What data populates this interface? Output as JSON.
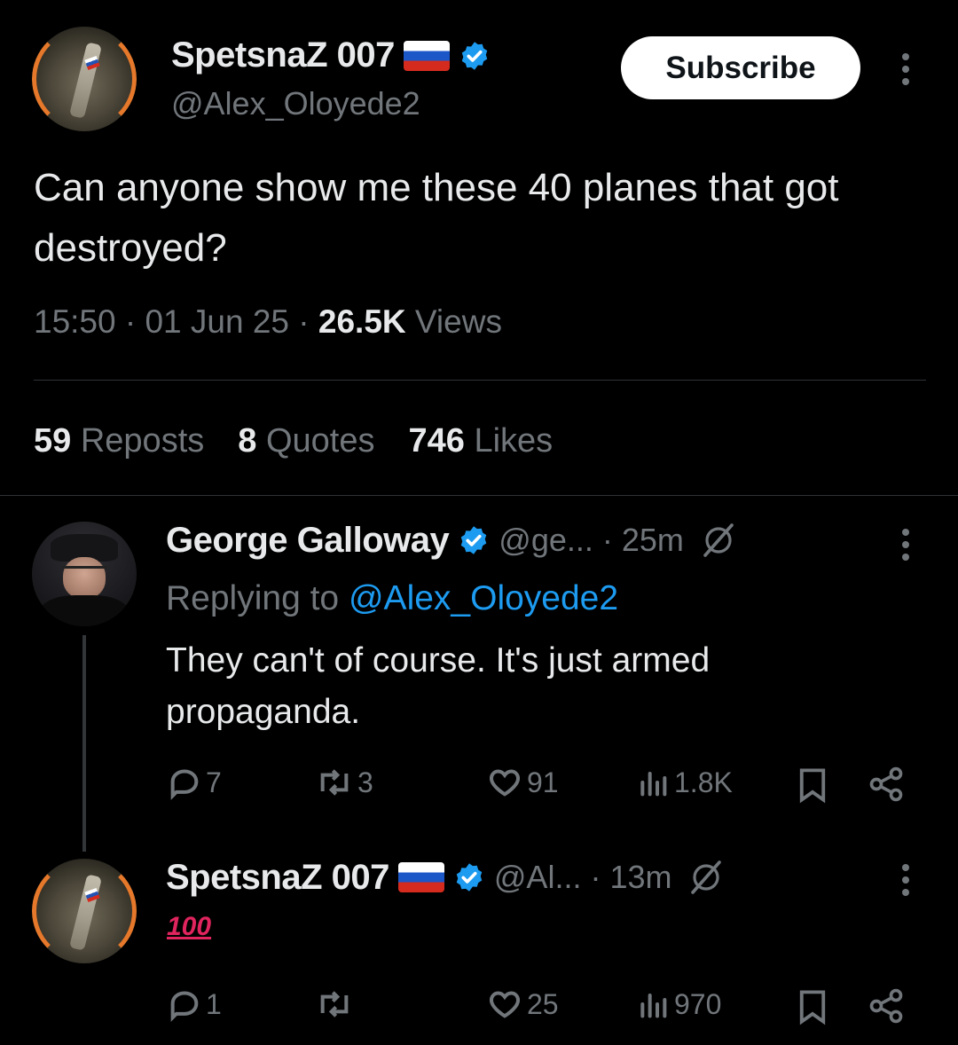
{
  "post": {
    "author_name": "SpetsnaZ 007",
    "author_handle": "@Alex_Oloyede2",
    "subscribe_label": "Subscribe",
    "text": "Can anyone show me these 40 planes that got destroyed?",
    "time": "15:50",
    "date": "01 Jun 25",
    "views_count": "26.5K",
    "views_label": "Views",
    "stats": {
      "reposts_count": "59",
      "reposts_label": "Reposts",
      "quotes_count": "8",
      "quotes_label": "Quotes",
      "likes_count": "746",
      "likes_label": "Likes"
    }
  },
  "replies": [
    {
      "author_name": "George Galloway",
      "author_handle": "@ge...",
      "age": "· 25m",
      "replying_prefix": "Replying to",
      "replying_handle": "@Alex_Oloyede2",
      "text": "They can't of course. It's just armed propaganda.",
      "counts": {
        "replies": "7",
        "reposts": "3",
        "likes": "91",
        "views": "1.8K"
      }
    },
    {
      "author_name": "SpetsnaZ 007",
      "author_handle": "@Al...",
      "age": "· 13m",
      "text": "100",
      "counts": {
        "replies": "1",
        "reposts": "",
        "likes": "25",
        "views": "970"
      }
    }
  ],
  "colors": {
    "background": "#000000",
    "text": "#e7e9ea",
    "muted": "#71767b",
    "link": "#1d9bf0",
    "verified": "#1d9bf0"
  },
  "icons": [
    "verified-badge-icon",
    "russia-flag-icon",
    "more-icon",
    "reply-icon",
    "repost-icon",
    "like-icon",
    "views-icon",
    "bookmark-icon",
    "share-icon",
    "grok-icon"
  ]
}
